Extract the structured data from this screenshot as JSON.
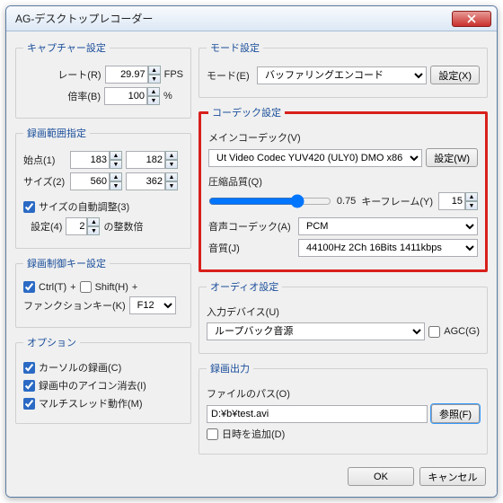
{
  "title": "AG-デスクトップレコーダー",
  "capture": {
    "legend": "キャプチャー設定",
    "rate_label": "レート(R)",
    "rate_value": "29.97",
    "fps": "FPS",
    "scale_label": "倍率(B)",
    "scale_value": "100",
    "pct": "%"
  },
  "range": {
    "legend": "録画範囲指定",
    "origin_label": "始点(1)",
    "ox": "183",
    "oy": "182",
    "size_label": "サイズ(2)",
    "sw": "560",
    "sh": "362",
    "auto_label": "サイズの自動調整(3)",
    "auto_checked": true,
    "setting_label": "設定(4)",
    "setting_value": "2",
    "mult_label": "の整数倍"
  },
  "hotkey": {
    "legend": "録画制御キー設定",
    "ctrl_label": "Ctrl(T)",
    "ctrl_checked": true,
    "plus": "+",
    "shift_label": "Shift(H)",
    "shift_checked": false,
    "fn_label": "ファンクションキー(K)",
    "fn_value": "F12"
  },
  "options": {
    "legend": "オプション",
    "cursor_label": "カーソルの録画(C)",
    "cursor_checked": true,
    "tray_label": "録画中のアイコン消去(I)",
    "tray_checked": true,
    "mt_label": "マルチスレッド動作(M)",
    "mt_checked": true
  },
  "mode": {
    "legend": "モード設定",
    "mode_label": "モード(E)",
    "mode_value": "バッファリングエンコード",
    "config_btn": "設定(X)"
  },
  "codec": {
    "legend": "コーデック設定",
    "main_label": "メインコーデック(V)",
    "main_value": "Ut Video Codec YUV420 (ULY0) DMO x86",
    "config_btn": "設定(W)",
    "quality_label": "圧縮品質(Q)",
    "quality_value": "0.75",
    "keyframe_label": "キーフレーム(Y)",
    "keyframe_value": "15",
    "audio_codec_label": "音声コーデック(A)",
    "audio_codec_value": "PCM",
    "quality2_label": "音質(J)",
    "quality2_value": "44100Hz 2Ch 16Bits 1411kbps"
  },
  "audio": {
    "legend": "オーディオ設定",
    "device_label": "入力デバイス(U)",
    "device_value": "ループバック音源",
    "agc_label": "AGC(G)",
    "agc_checked": false
  },
  "output": {
    "legend": "録画出力",
    "path_label": "ファイルのパス(O)",
    "path_value": "D:¥b¥test.avi",
    "browse_btn": "参照(F)",
    "datetime_label": "日時を追加(D)",
    "datetime_checked": false
  },
  "buttons": {
    "ok": "OK",
    "cancel": "キャンセル"
  }
}
